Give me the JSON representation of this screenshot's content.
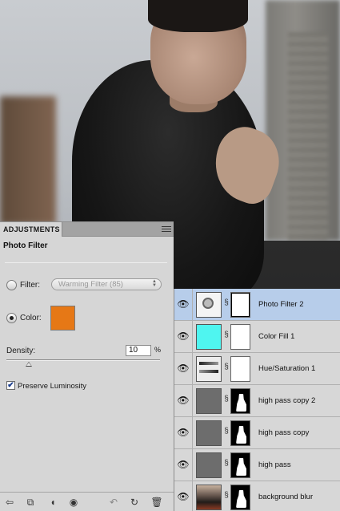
{
  "adjustments": {
    "tab_label": "ADJUSTMENTS",
    "title": "Photo Filter",
    "filter_label": "Filter:",
    "filter_value": "Warming Filter (85)",
    "color_label": "Color:",
    "color_value": "#e67816",
    "density_label": "Density:",
    "density_value": "10",
    "density_unit": "%",
    "density_level": 0.1,
    "preserve_label": "Preserve Luminosity",
    "preserve_checked": true,
    "selected_option": "color"
  },
  "footer_icons": [
    "back-arrow-icon",
    "panel-switch-icon",
    "clip-layer-icon",
    "visibility-icon",
    "previous-state-icon",
    "reset-icon",
    "trash-icon"
  ],
  "layers": [
    {
      "name": "Photo Filter 2",
      "thumb": "photo-filter",
      "mask": "white",
      "selected": true
    },
    {
      "name": "Color Fill 1",
      "thumb": "color-fill",
      "mask": "white",
      "selected": false
    },
    {
      "name": "Hue/Saturation 1",
      "thumb": "hue-saturation",
      "mask": "white",
      "selected": false
    },
    {
      "name": "high pass copy 2",
      "thumb": "gray",
      "mask": "silhouette",
      "selected": false
    },
    {
      "name": "high pass copy",
      "thumb": "gray",
      "mask": "silhouette",
      "selected": false
    },
    {
      "name": "high pass",
      "thumb": "gray",
      "mask": "silhouette",
      "selected": false
    },
    {
      "name": "background blur",
      "thumb": "photo",
      "mask": "silhouette",
      "selected": false
    }
  ],
  "colors": {
    "selected_layer": "#b7cdea",
    "color_fill_swatch": "#4ff5f0"
  }
}
